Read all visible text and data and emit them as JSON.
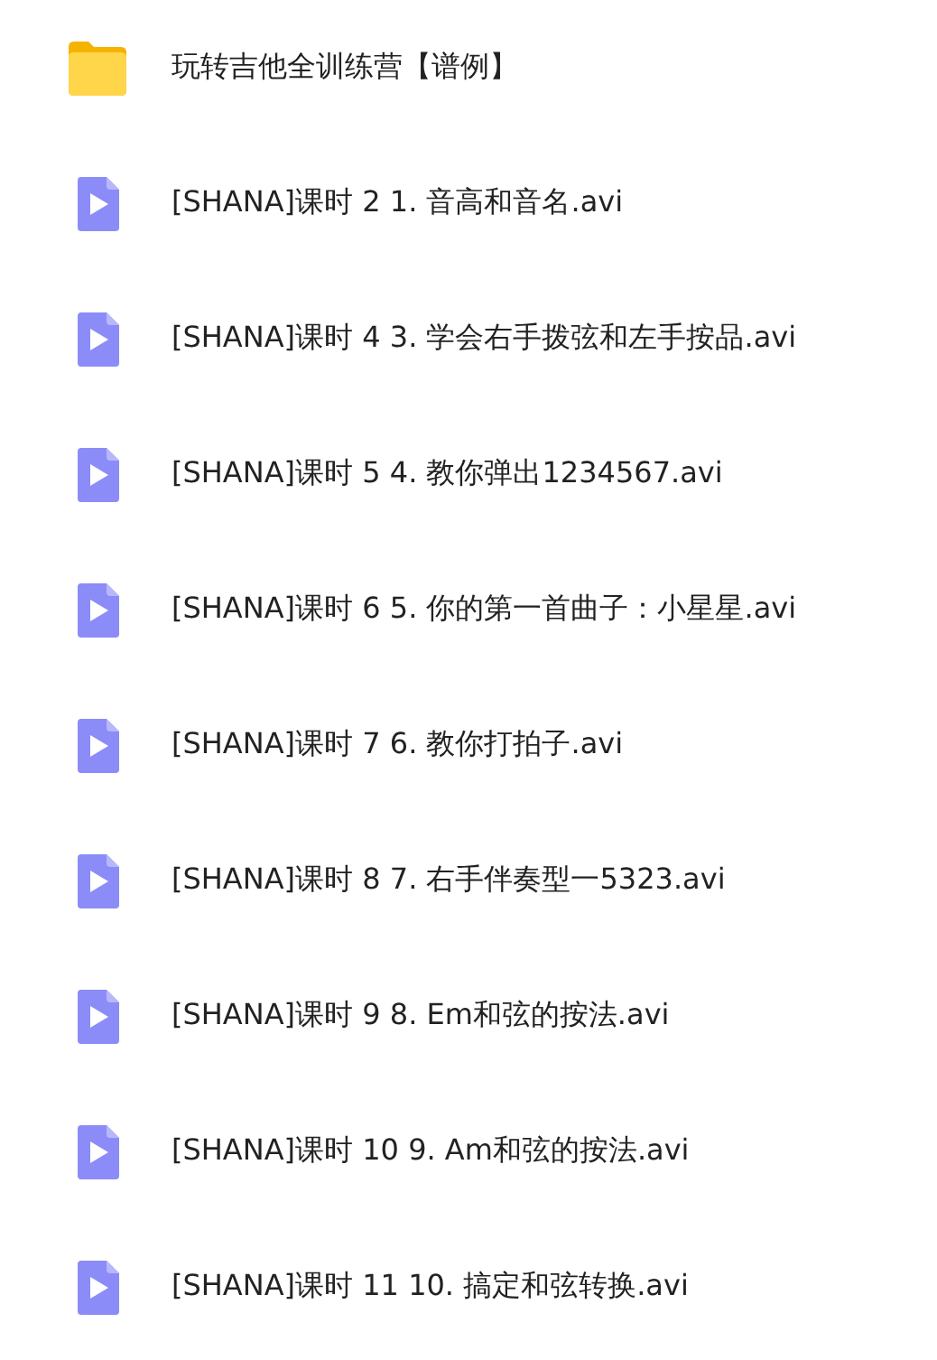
{
  "files": [
    {
      "kind": "folder",
      "name": "玩转吉他全训练营【谱例】"
    },
    {
      "kind": "video",
      "name": "[SHANA]课时 2 1. 音高和音名.avi"
    },
    {
      "kind": "video",
      "name": "[SHANA]课时 4 3. 学会右手拨弦和左手按品.avi"
    },
    {
      "kind": "video",
      "name": "[SHANA]课时 5 4. 教你弹出1234567.avi"
    },
    {
      "kind": "video",
      "name": "[SHANA]课时 6 5. 你的第一首曲子：小星星.avi"
    },
    {
      "kind": "video",
      "name": "[SHANA]课时 7 6. 教你打拍子.avi"
    },
    {
      "kind": "video",
      "name": "[SHANA]课时 8 7. 右手伴奏型一5323.avi"
    },
    {
      "kind": "video",
      "name": "[SHANA]课时 9 8. Em和弦的按法.avi"
    },
    {
      "kind": "video",
      "name": "[SHANA]课时 10 9. Am和弦的按法.avi"
    },
    {
      "kind": "video",
      "name": "[SHANA]课时 11 10. 搞定和弦转换.avi"
    }
  ]
}
